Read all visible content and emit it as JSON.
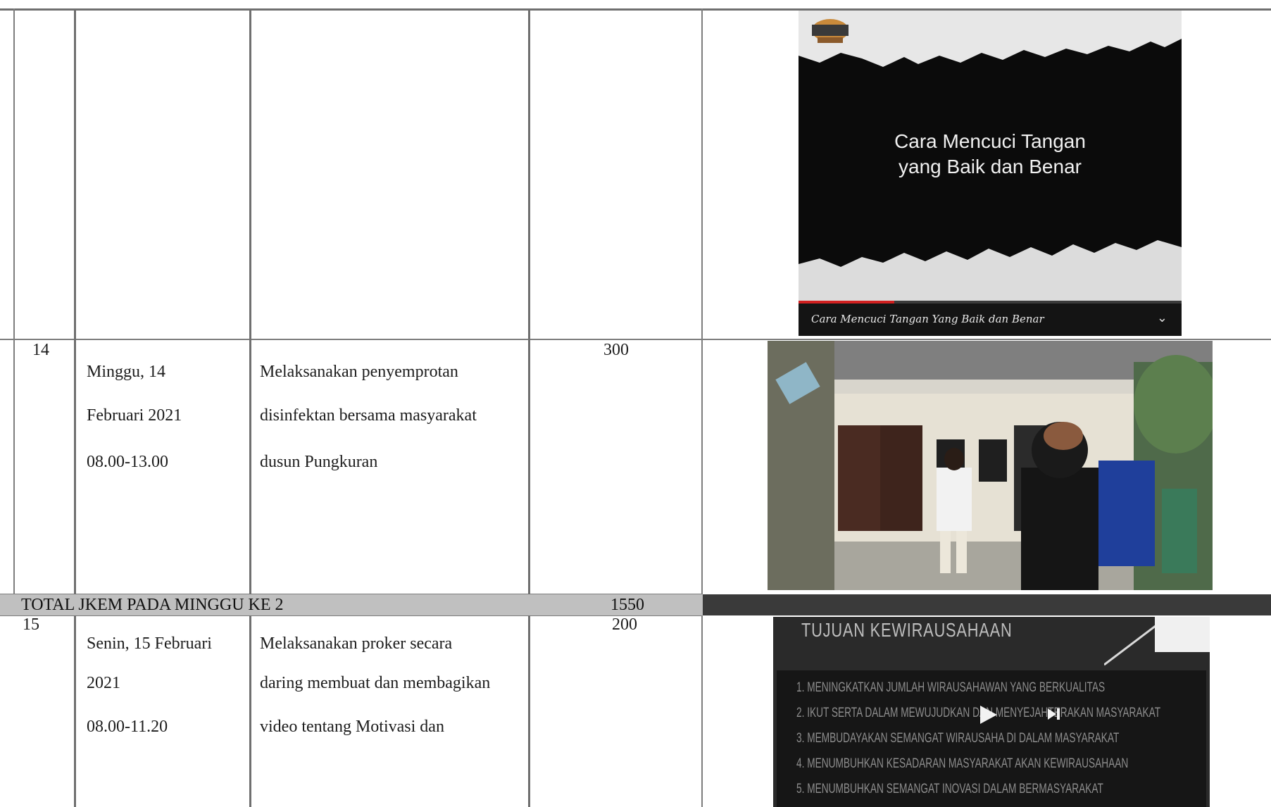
{
  "rows": [
    {
      "no": "",
      "date_line1": "",
      "date_line2": "",
      "time": "",
      "activity": "",
      "jkem": ""
    },
    {
      "no": "14",
      "date_line1": "Minggu, 14",
      "date_line2": "Februari 2021",
      "time": "08.00-13.00",
      "activity_line1": "Melaksanakan penyemprotan",
      "activity_line2": "disinfektan bersama masyarakat",
      "activity_line3": "dusun Pungkuran",
      "jkem": "300"
    },
    {
      "no": "15",
      "date_line1": "Senin, 15 Februari",
      "date_line2": "2021",
      "time": "08.00-11.20",
      "activity_line1": "Melaksanakan proker secara",
      "activity_line2": "daring membuat dan membagikan",
      "activity_line3": "video tentang Motivasi dan",
      "jkem": "200"
    }
  ],
  "total": {
    "label": "TOTAL JKEM PADA MINGGU KE 2",
    "value": "1550"
  },
  "photos": {
    "video_thumbnail": {
      "title_line1": "Cara Mencuci Tangan",
      "title_line2": "yang Baik dan Benar",
      "caption": "Cara Mencuci Tangan Yang Baik dan Benar",
      "progress": 0.25,
      "chevron_icon": "chevron-down-icon"
    },
    "slide": {
      "title": "TUJUAN KEWIRAUSAHAAN",
      "lines": [
        "1. MENINGKATKAN JUMLAH WIRAUSAHAWAN YANG BERKUALITAS",
        "2. IKUT SERTA DALAM MEWUJUDKAN DAN MENYEJAHTERAKAN MASYARAKAT",
        "3. MEMBUDAYAKAN SEMANGAT WIRAUSAHA DI DALAM MASYARAKAT",
        "4. MENUMBUHKAN KESADARAN MASYARAKAT AKAN KEWIRAUSAHAAN",
        "5. MENUMBUHKAN SEMANGAT INOVASI DALAM BERMASYARAKAT"
      ],
      "play_icon": "play-icon",
      "next_icon": "next-icon"
    }
  }
}
